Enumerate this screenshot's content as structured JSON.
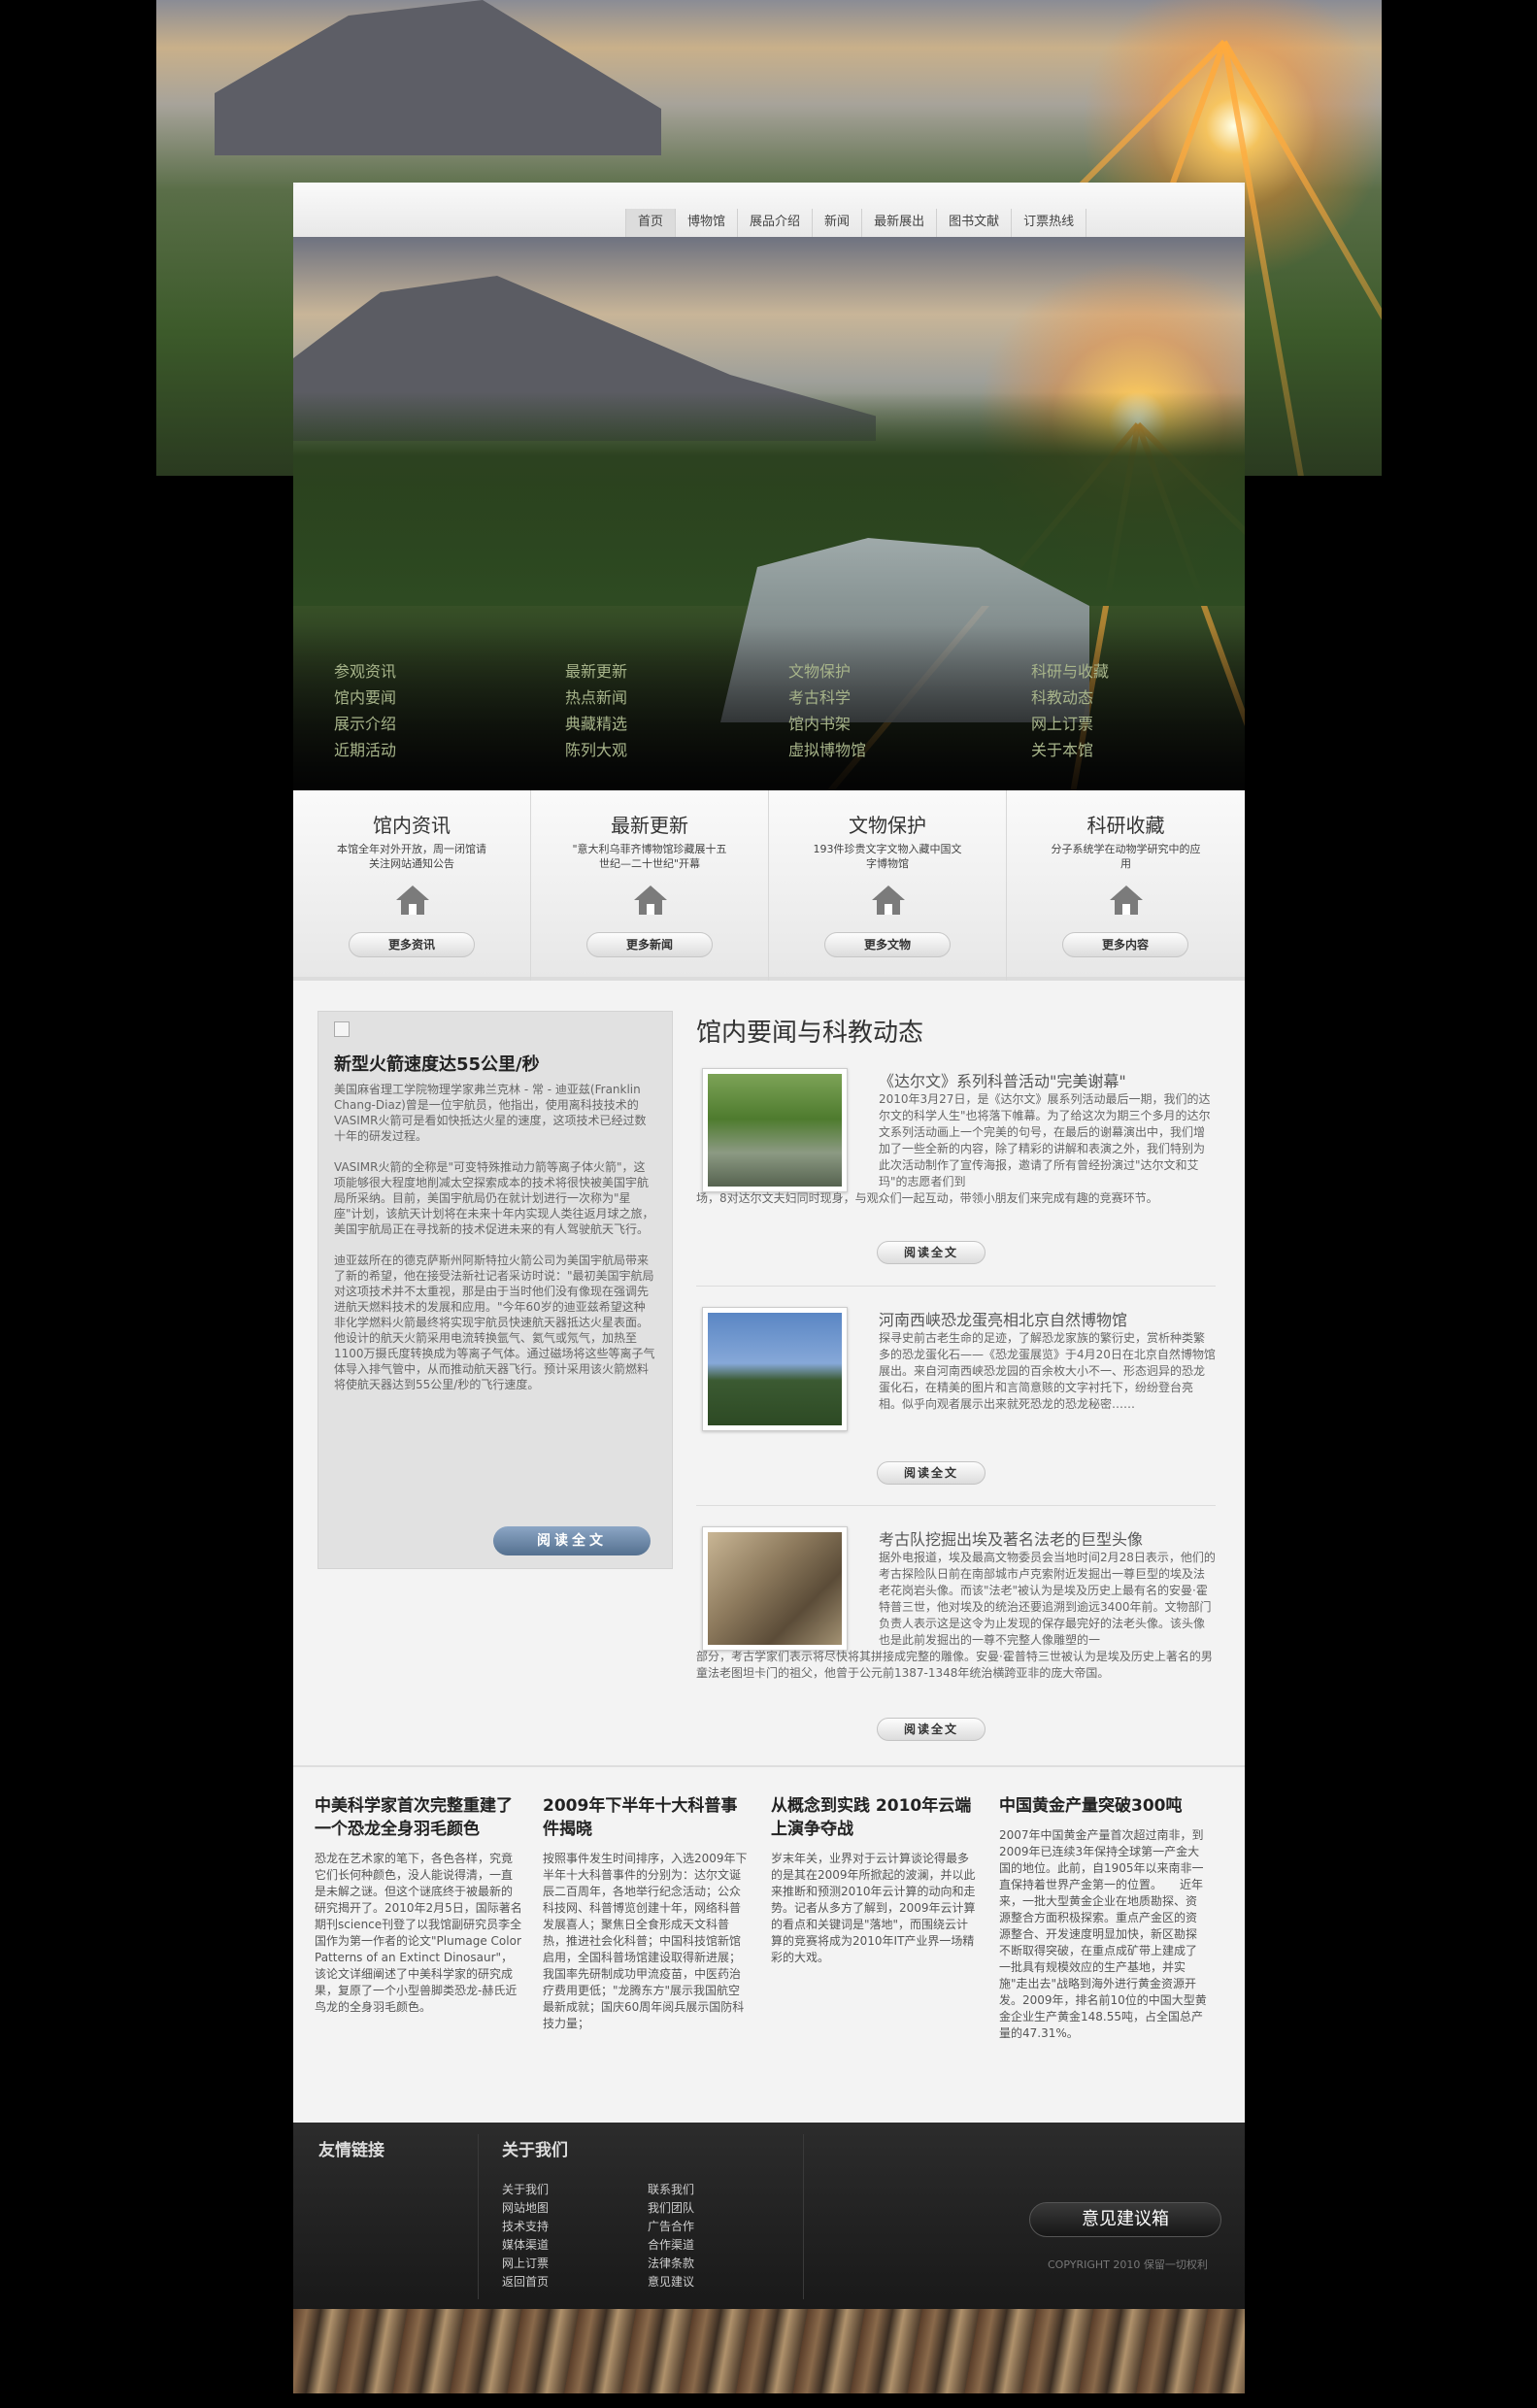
{
  "nav": {
    "items": [
      "首页",
      "博物馆",
      "展品介绍",
      "新闻",
      "最新展出",
      "图书文献",
      "订票热线"
    ],
    "active_index": 0
  },
  "hero": {
    "columns": [
      [
        "参观资讯",
        "馆内要闻",
        "展示介绍",
        "近期活动"
      ],
      [
        "最新更新",
        "热点新闻",
        "典藏精选",
        "陈列大观"
      ],
      [
        "文物保护",
        "考古科学",
        "馆内书架",
        "虚拟博物馆"
      ],
      [
        "科研与收藏",
        "科教动态",
        "网上订票",
        "关于本馆"
      ]
    ]
  },
  "features": [
    {
      "title": "馆内资讯",
      "desc": "本馆全年对外开放，周一闭馆请关注网站通知公告",
      "icon": "home-icon",
      "button": "更多资讯"
    },
    {
      "title": "最新更新",
      "desc": "\"意大利乌菲齐博物馆珍藏展十五世纪—二十世纪\"开幕",
      "icon": "home-icon",
      "button": "更多新闻"
    },
    {
      "title": "文物保护",
      "desc": "193件珍贵文字文物入藏中国文字博物馆",
      "icon": "home-icon",
      "button": "更多文物"
    },
    {
      "title": "科研收藏",
      "desc": "分子系统学在动物学研究中的应用",
      "icon": "home-icon",
      "button": "更多内容"
    }
  ],
  "left_article": {
    "title": "新型火箭速度达55公里/秒",
    "paragraphs": [
      "美国麻省理工学院物理学家弗兰克林 - 常 - 迪亚兹(Franklin Chang-Diaz)曾是一位宇航员，他指出，使用离科技技术的VASIMR火箭可是看如快抵达火星的速度，这项技术已经过数十年的研发过程。",
      "VASIMR火箭的全称是\"可变特殊推动力箭等离子体火箭\"，这项能够很大程度地削减太空探索成本的技术将很快被美国宇航局所采纳。目前，美国宇航局仍在就计划进行一次称为\"星座\"计划，该航天计划将在未来十年内实现人类往返月球之旅，美国宇航局正在寻找新的技术促进未来的有人驾驶航天飞行。",
      "迪亚兹所在的德克萨斯州阿斯特拉火箭公司为美国宇航局带来了新的希望，他在接受法新社记者采访时说：\"最初美国宇航局对这项技术并不太重视，那是由于当时他们没有像现在强调先进航天燃料技术的发展和应用。\"今年60岁的迪亚兹希望这种非化学燃料火箭最终将实现宇航员快速航天器抵达火星表面。他设计的航天火箭采用电流转换氩气、氦气或氖气，加热至1100万摄氏度转换成为等离子气体。通过磁场将这些等离子气体导入排气管中，从而推动航天器飞行。预计采用该火箭燃料将使航天器达到55公里/秒的飞行速度。"
    ],
    "button": "阅读全文"
  },
  "news_section": {
    "title": "馆内要闻与科教动态",
    "items": [
      {
        "title": "《达尔文》系列科普活动\"完美谢幕\"",
        "body_indented": "2010年3月27日，是《达尔文》展系列活动最后一期，我们的达尔文的科学人生\"也将落下帷幕。为了给这次为期三个多月的达尔文系列活动画上一个完美的句号，在最后的谢幕演出中，我们增加了一些全新的内容，除了精彩的讲解和表演之外，我们特别为此次活动制作了宣传海报，邀请了所有曾经扮演过\"达尔文和艾玛\"的志愿者们到",
        "body_full": "场，8对达尔文夫妇同时现身，与观众们一起互动，带领小朋友们来完成有趣的竞赛环节。",
        "button": "阅读全文"
      },
      {
        "title": "河南西峡恐龙蛋亮相北京自然博物馆",
        "body_indented": "探寻史前古老生命的足迹，了解恐龙家族的繁衍史，赏析种类繁多的恐龙蛋化石——《恐龙蛋展览》于4月20日在北京自然博物馆展出。来自河南西峡恐龙园的百余枚大小不一、形态迥异的恐龙蛋化石，在精美的图片和言简意赅的文字衬托下，纷纷登台亮相。似乎向观者展示出来就死恐龙的恐龙秘密……",
        "body_full": "",
        "button": "阅读全文"
      },
      {
        "title": "考古队挖掘出埃及著名法老的巨型头像",
        "body_indented": "据外电报道，埃及最高文物委员会当地时间2月28日表示，他们的考古探险队日前在南部城市卢克索附近发掘出一尊巨型的埃及法老花岗岩头像。而该\"法老\"被认为是埃及历史上最有名的安曼·霍特普三世，他对埃及的统治还要追溯到逾远3400年前。文物部门负责人表示这是这令为止发现的保存最完好的法老头像。该头像也是此前发掘出的一尊不完整人像雕塑的一",
        "body_full": "部分，考古学家们表示将尽快将其拼接成完整的雕像。安曼·霍普特三世被认为是埃及历史上著名的男童法老图坦卡门的祖父，他曾于公元前1387-1348年统治横跨亚非的庞大帝国。",
        "button": "阅读全文"
      }
    ]
  },
  "bottom_columns": [
    {
      "title": "中美科学家首次完整重建了一个恐龙全身羽毛颜色",
      "body": "恐龙在艺术家的笔下，各色各样，究竟它们长何种颜色，没人能说得清，一直是未解之谜。但这个谜底终于被最新的研究揭开了。2010年2月5日，国际著名期刊science刊登了以我馆副研究员李全国作为第一作者的论文\"Plumage Color Patterns of an Extinct Dinosaur\"，该论文详细阐述了中美科学家的研究成果，复原了一个小型兽脚类恐龙-赫氏近鸟龙的全身羽毛颜色。"
    },
    {
      "title": "2009年下半年十大科普事件揭晓",
      "body": "按照事件发生时间排序，入选2009年下半年十大科普事件的分别为：达尔文诞辰二百周年，各地举行纪念活动；公众科技网、科普博览创建十年，网络科普发展喜人；聚焦日全食形成天文科普热，推进社会化科普；中国科技馆新馆启用，全国科普场馆建设取得新进展；我国率先研制成功甲流疫苗，中医药治疗费用更低；\"龙腾东方\"展示我国航空最新成就；国庆60周年阅兵展示国防科技力量；"
    },
    {
      "title": "从概念到实践 2010年云端上演争夺战",
      "body": "岁末年关，业界对于云计算谈论得最多的是其在2009年所掀起的波澜，并以此来推断和预测2010年云计算的动向和走势。记者从多方了解到，2009年云计算的看点和关键词是\"落地\"，而围绕云计算的竞赛将成为2010年IT产业界一场精彩的大戏。"
    },
    {
      "title": "中国黄金产量突破300吨",
      "body": "2007年中国黄金产量首次超过南非，到2009年已连续3年保持全球第一产金大国的地位。此前，自1905年以来南非一直保持着世界产金第一的位置。　　近年来，一批大型黄金企业在地质勘探、资源整合方面积极探索。重点产金区的资源整合、开发速度明显加快，新区勘探不断取得突破，在重点成矿带上建成了一批具有规模效应的生产基地，并实施\"走出去\"战略到海外进行黄金资源开发。2009年，排名前10位的中国大型黄金企业生产黄金148.55吨，占全国总产量的47.31%。"
    }
  ],
  "footer": {
    "friend_links_title": "友情链接",
    "about_title": "关于我们",
    "about_links_1": [
      "关于我们",
      "网站地图",
      "技术支持",
      "媒体渠道",
      "网上订票",
      "返回首页"
    ],
    "about_links_2": [
      "联系我们",
      "我们团队",
      "广告合作",
      "合作渠道",
      "法律条款",
      "意见建议"
    ],
    "suggest_button": "意见建议箱",
    "copyright": "COPYRIGHT 2010 保留一切权利"
  },
  "colors": {
    "hero_link": "#a7b48a",
    "read_button_blue": "#6a86a8",
    "footer_bg": "#1e1e1e"
  }
}
